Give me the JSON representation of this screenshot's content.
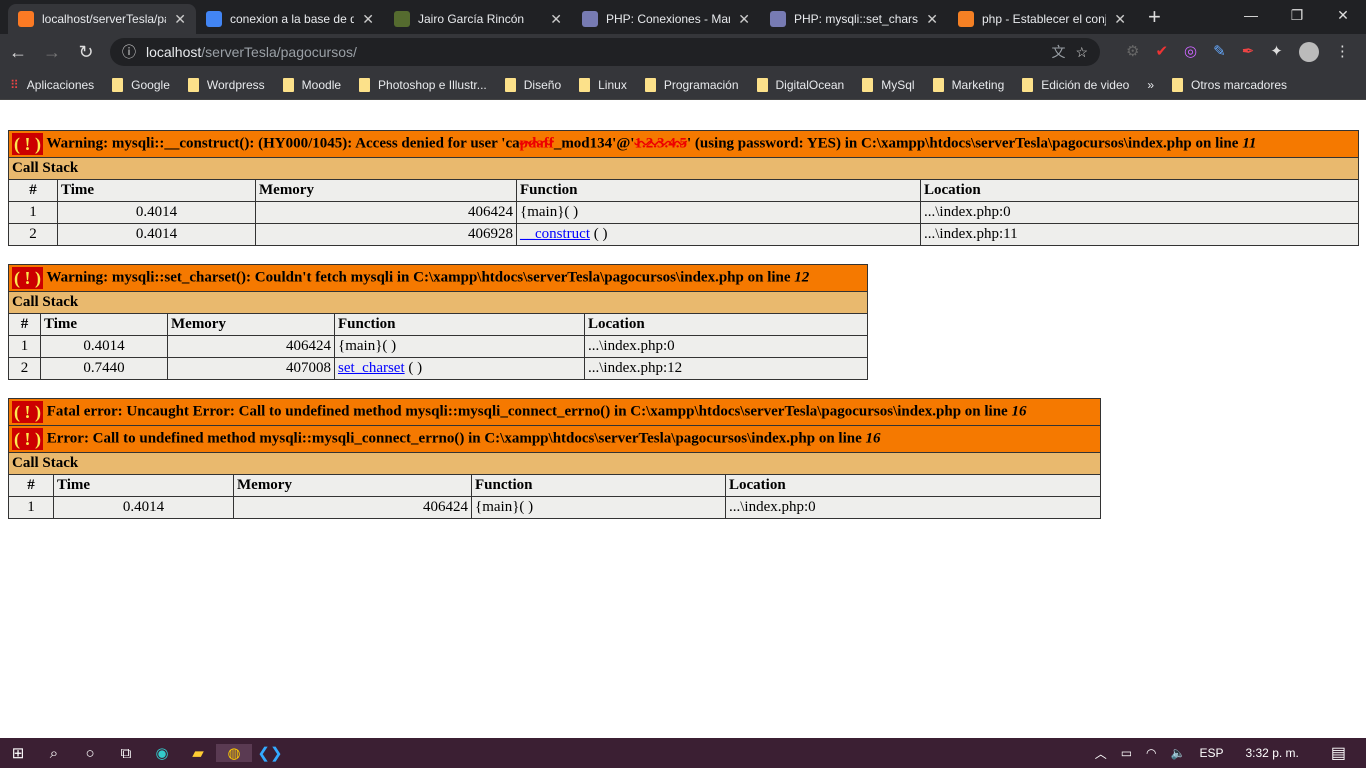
{
  "browser": {
    "tabs": [
      {
        "title": "localhost/serverTesla/pagocursos/",
        "icon": "xampp-icon",
        "color": "#fb7a24",
        "active": true
      },
      {
        "title": "conexion a la base de datos",
        "icon": "google-icon",
        "color": "#4285f4"
      },
      {
        "title": "Jairo García Rincón",
        "icon": "avatar-icon",
        "color": "#556b2f"
      },
      {
        "title": "PHP: Conexiones - Manual",
        "icon": "php-icon",
        "color": "#777bb3"
      },
      {
        "title": "PHP: mysqli::set_charset",
        "icon": "php-icon",
        "color": "#777bb3"
      },
      {
        "title": "php - Establecer el conjunto",
        "icon": "stackoverflow-icon",
        "color": "#f48024"
      }
    ],
    "url_host": "localhost",
    "url_path": "/serverTesla/pagocursos/",
    "bookmarks": [
      "Aplicaciones",
      "Google",
      "Wordpress",
      "Moodle",
      "Photoshop e Illustr...",
      "Diseño",
      "Linux",
      "Programación",
      "DigitalOcean",
      "MySql",
      "Marketing",
      "Edición de video"
    ],
    "more": "»",
    "other_bookmarks": "Otros marcadores"
  },
  "errors": [
    {
      "titles": [
        {
          "pre": "Warning: mysqli::__construct(): (HY000/1045): Access denied for user 'ca",
          "redacted1": "pdaff",
          "mid": "_mod134'@'",
          "redacted2": "1.2.3.4.5",
          "post": "' (using password: YES) in C:\\xampp\\htdocs\\serverTesla\\pagocursos\\index.php on line ",
          "line": "11"
        }
      ],
      "call_stack": "Call Stack",
      "headers": [
        "#",
        "Time",
        "Memory",
        "Function",
        "Location"
      ],
      "rows": [
        [
          "1",
          "0.4014",
          "406424",
          "{main}( )",
          "...\\index.php:0"
        ],
        [
          "2",
          "0.4014",
          "406928",
          "__construct",
          "...\\index.php:11"
        ]
      ]
    },
    {
      "titles": [
        {
          "pre": "Warning: mysqli::set_charset(): Couldn't fetch mysqli in C:\\xampp\\htdocs\\serverTesla\\pagocursos\\index.php on line ",
          "line": "12"
        }
      ],
      "call_stack": "Call Stack",
      "headers": [
        "#",
        "Time",
        "Memory",
        "Function",
        "Location"
      ],
      "rows": [
        [
          "1",
          "0.4014",
          "406424",
          "{main}( )",
          "...\\index.php:0"
        ],
        [
          "2",
          "0.7440",
          "407008",
          "set_charset",
          "...\\index.php:12"
        ]
      ]
    },
    {
      "titles": [
        {
          "pre": "Fatal error: Uncaught Error: Call to undefined method mysqli::mysqli_connect_errno() in C:\\xampp\\htdocs\\serverTesla\\pagocursos\\index.php on line ",
          "line": "16"
        },
        {
          "pre": "Error: Call to undefined method mysqli::mysqli_connect_errno() in C:\\xampp\\htdocs\\serverTesla\\pagocursos\\index.php on line ",
          "line": "16"
        }
      ],
      "call_stack": "Call Stack",
      "headers": [
        "#",
        "Time",
        "Memory",
        "Function",
        "Location"
      ],
      "rows": [
        [
          "1",
          "0.4014",
          "406424",
          "{main}( )",
          "...\\index.php:0"
        ]
      ]
    }
  ],
  "bang": "( ! )",
  "fn_suffix": " ( )",
  "taskbar": {
    "lang": "ESP",
    "time": "3:32 p. m."
  }
}
